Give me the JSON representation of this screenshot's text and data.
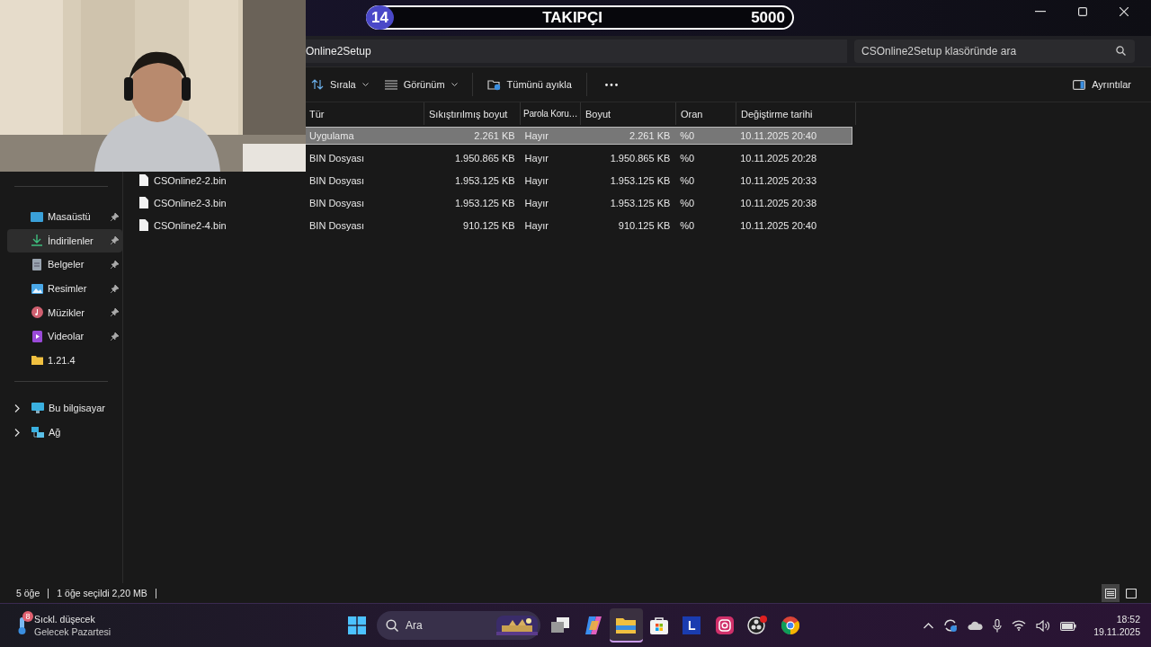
{
  "stream_overlay": {
    "badge": "14",
    "title": "TAKIPÇI",
    "goal": "5000"
  },
  "address_bar": {
    "path": "Online2Setup"
  },
  "search": {
    "placeholder": "CSOnline2Setup klasöründe ara"
  },
  "toolbar": {
    "sort": "Sırala",
    "view": "Görünüm",
    "extract": "Tümünü ayıkla",
    "details": "Ayrıntılar"
  },
  "sidebar": {
    "quick_access": [
      {
        "label": "Masaüstü",
        "kind": "desktop",
        "pinned": true,
        "selected": false
      },
      {
        "label": "İndirilenler",
        "kind": "download",
        "pinned": true,
        "selected": true
      },
      {
        "label": "Belgeler",
        "kind": "document",
        "pinned": true,
        "selected": false
      },
      {
        "label": "Resimler",
        "kind": "pictures",
        "pinned": true,
        "selected": false
      },
      {
        "label": "Müzikler",
        "kind": "music",
        "pinned": true,
        "selected": false
      },
      {
        "label": "Videolar",
        "kind": "video",
        "pinned": true,
        "selected": false
      },
      {
        "label": "1.21.4",
        "kind": "folder",
        "pinned": false,
        "selected": false
      }
    ],
    "locations": [
      {
        "label": "Bu bilgisayar",
        "kind": "computer",
        "expanded": false
      },
      {
        "label": "Ağ",
        "kind": "network",
        "expanded": false
      }
    ]
  },
  "table": {
    "columns": [
      "Tür",
      "Sıkıştırılmış boyut",
      "Parola Koru…",
      "Boyut",
      "Oran",
      "Değiştirme tarihi"
    ],
    "rows": [
      {
        "type": "Uygulama",
        "compressed": "2.261 KB",
        "password": "Hayır",
        "size": "2.261 KB",
        "ratio": "%0",
        "modified": "10.11.2025 20:40",
        "selected": true
      },
      {
        "type": "BIN Dosyası",
        "compressed": "1.950.865 KB",
        "password": "Hayır",
        "size": "1.950.865 KB",
        "ratio": "%0",
        "modified": "10.11.2025 20:28",
        "selected": false
      },
      {
        "name": "CSOnline2-2.bin",
        "type": "BIN Dosyası",
        "compressed": "1.953.125 KB",
        "password": "Hayır",
        "size": "1.953.125 KB",
        "ratio": "%0",
        "modified": "10.11.2025 20:33",
        "selected": false
      },
      {
        "name": "CSOnline2-3.bin",
        "type": "BIN Dosyası",
        "compressed": "1.953.125 KB",
        "password": "Hayır",
        "size": "1.953.125 KB",
        "ratio": "%0",
        "modified": "10.11.2025 20:38",
        "selected": false
      },
      {
        "name": "CSOnline2-4.bin",
        "type": "BIN Dosyası",
        "compressed": "910.125 KB",
        "password": "Hayır",
        "size": "910.125 KB",
        "ratio": "%0",
        "modified": "10.11.2025 20:40",
        "selected": false
      }
    ]
  },
  "status_bar": {
    "count": "5 öğe",
    "selection": "1 öğe seçildi  2,20 MB",
    "views": [
      {
        "kind": "details",
        "selected": true
      },
      {
        "kind": "tiles",
        "selected": false
      }
    ]
  },
  "taskbar": {
    "weather": {
      "badge": "8",
      "title": "Sıckl. düşecek",
      "subtitle": "Gelecek Pazartesi"
    },
    "search": {
      "placeholder": "Ara"
    },
    "apps": [
      {
        "kind": "taskview",
        "active": false
      },
      {
        "kind": "copilot",
        "active": false
      },
      {
        "kind": "explorer",
        "active": true
      },
      {
        "kind": "store",
        "active": false
      },
      {
        "kind": "letter",
        "label": "L",
        "active": false
      },
      {
        "kind": "instagram",
        "active": false
      },
      {
        "kind": "obs",
        "active": false
      },
      {
        "kind": "chrome",
        "active": false
      }
    ],
    "clock": {
      "time": "18:52",
      "date": "19.11.2025"
    }
  }
}
